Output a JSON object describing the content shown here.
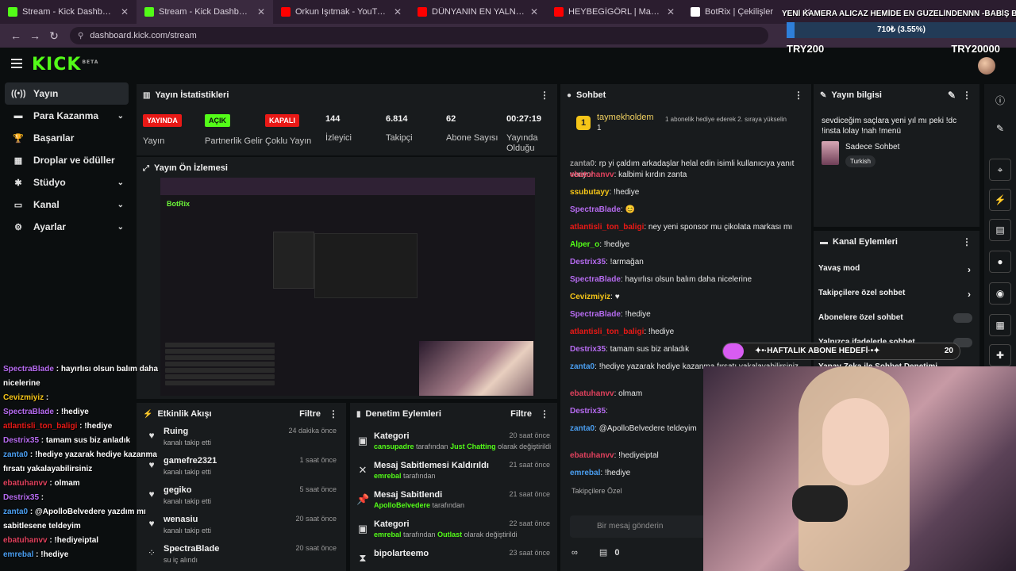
{
  "tabs": [
    {
      "label": "Stream - Kick Dashboard",
      "color": "#53fc18"
    },
    {
      "label": "Stream - Kick Dashboard",
      "color": "#53fc18"
    },
    {
      "label": "Orkun Işıtmak - YouTube",
      "color": "#ff0000"
    },
    {
      "label": "DÜNYANIN EN YALNIZ EVİNDE",
      "color": "#ff0000"
    },
    {
      "label": "HEYBEGİGÖRL | Madara Olduk",
      "color": "#ff0000"
    },
    {
      "label": "BotRix | Çekilişler",
      "color": "#ffffff"
    }
  ],
  "url": "dashboard.kick.com/stream",
  "goal": {
    "title": "YENİ KAMERA ALICAZ HEMİDE EN GÜZELİNDENNN -BABİŞ BABI",
    "progress_text": "710₺ (3.55%)",
    "progress_fraction": 0.0355,
    "min": "TRY200",
    "max": "TRY20000"
  },
  "sidebar": [
    {
      "label": "Yayın",
      "icon": "broadcast-icon",
      "glyph": "((•))",
      "chevron": false
    },
    {
      "label": "Para Kazanma",
      "icon": "wallet-icon",
      "glyph": "▬",
      "chevron": true
    },
    {
      "label": "Başarılar",
      "icon": "trophy-icon",
      "glyph": "🏆",
      "chevron": false
    },
    {
      "label": "Droplar ve ödüller",
      "icon": "gift-icon",
      "glyph": "▦",
      "chevron": false
    },
    {
      "label": "Stüdyo",
      "icon": "settings-icon",
      "glyph": "✱",
      "chevron": true
    },
    {
      "label": "Kanal",
      "icon": "channel-icon",
      "glyph": "▭",
      "chevron": true
    },
    {
      "label": "Ayarlar",
      "icon": "gear-icon",
      "glyph": "⚙",
      "chevron": true
    }
  ],
  "stats": {
    "title": "Yayın İstatistikleri",
    "items": [
      {
        "badge": "YAYINDA",
        "badge_color": "#e91916",
        "label": "Yayın"
      },
      {
        "badge": "AÇIK",
        "badge_color": "#53fc18",
        "label": "Partnerlik Gelir"
      },
      {
        "badge": "KAPALI",
        "badge_color": "#e91916",
        "label": "Çoklu Yayın"
      },
      {
        "value": "144",
        "label": "İzleyici"
      },
      {
        "value": "6.814",
        "label": "Takipçi"
      },
      {
        "value": "62",
        "label": "Abone Sayısı"
      },
      {
        "value": "00:27:19",
        "label": "Yayında Olduğu"
      }
    ]
  },
  "preview": {
    "title": "Yayın Ön İzlemesi",
    "botrix": "BotRix"
  },
  "feed": {
    "title": "Etkinlik Akışı",
    "filter": "Filtre",
    "items": [
      {
        "name": "Ruing",
        "desc": "kanalı takip etti",
        "time": "24 dakika önce",
        "icon": "heart-icon",
        "glyph": "♥"
      },
      {
        "name": "gamefre2321",
        "desc": "kanalı takip etti",
        "time": "1 saat önce",
        "icon": "heart-icon",
        "glyph": "♥"
      },
      {
        "name": "gegiko",
        "desc": "kanalı takip etti",
        "time": "5 saat önce",
        "icon": "heart-icon",
        "glyph": "♥"
      },
      {
        "name": "wenasiu",
        "desc": "kanalı takip etti",
        "time": "20 saat önce",
        "icon": "heart-icon",
        "glyph": "♥"
      },
      {
        "name": "SpectraBlade",
        "desc": "su iç alındı",
        "time": "20 saat önce",
        "icon": "redeem-icon",
        "glyph": "⁘"
      }
    ]
  },
  "mod": {
    "title": "Denetim Eylemleri",
    "filter": "Filtre",
    "items": [
      {
        "title": "Kategori",
        "user": "cansupadre",
        "mid": " tarafından ",
        "target": "Just Chatting",
        "tail": " olarak değiştirildi",
        "time": "20 saat önce",
        "icon": "category-icon",
        "glyph": "▣"
      },
      {
        "title": "Mesaj Sabitlemesi Kaldırıldı",
        "user": "emrebal",
        "mid": " tarafından",
        "target": "",
        "tail": "",
        "time": "21 saat önce",
        "icon": "unpin-icon",
        "glyph": "✕"
      },
      {
        "title": "Mesaj Sabitlendi",
        "user": "ApolloBelvedere",
        "mid": " tarafından",
        "target": "",
        "tail": "",
        "time": "21 saat önce",
        "icon": "pin-icon",
        "glyph": "📌"
      },
      {
        "title": "Kategori",
        "user": "emrebal",
        "mid": " tarafından ",
        "target": "Outlast",
        "tail": " olarak değiştirildi",
        "time": "22 saat önce",
        "icon": "category-icon",
        "glyph": "▣"
      },
      {
        "title": "bipolarteemo",
        "user": "",
        "mid": "",
        "target": "",
        "tail": "",
        "time": "23 saat önce",
        "icon": "hourglass-icon",
        "glyph": "⧗"
      }
    ]
  },
  "chat": {
    "title": "Sohbet",
    "pinned_user": "taymekholdem",
    "pinned_count": "1",
    "pinned_msg": "1 abonelik hediye ederek 2. sıraya yükselin",
    "messages": [
      {
        "user": "zanta0",
        "color": "#9a9a9a",
        "text": "rp yi çaldım arkadaşlar helal edin isimli kullanıcıya yanıt veriyor"
      },
      {
        "user": "ebatuhanvv",
        "color": "#e0415d",
        "text": "kalbimi kırdın zanta"
      },
      {
        "user": "ssubutayy",
        "color": "#f5c518",
        "text": "!hediye"
      },
      {
        "user": "SpectraBlade",
        "color": "#b66bf0",
        "text": "😊"
      },
      {
        "user": "atlantisli_ton_baligi",
        "color": "#e91916",
        "text": "ney yeni sponsor mu çikolata markası mı"
      },
      {
        "user": "Alper_o",
        "color": "#53fc18",
        "text": "!hediye"
      },
      {
        "user": "Destrix35",
        "color": "#b66bf0",
        "text": "!armağan"
      },
      {
        "user": "SpectraBlade",
        "color": "#b66bf0",
        "text": "hayırlısı olsun balım daha nicelerine"
      },
      {
        "user": "Cevizmiyiz",
        "color": "#f5c518",
        "text": "♥"
      },
      {
        "user": "SpectraBlade",
        "color": "#b66bf0",
        "text": "!hediye"
      },
      {
        "user": "atlantisli_ton_baligi",
        "color": "#e91916",
        "text": "!hediye"
      },
      {
        "user": "Destrix35",
        "color": "#b66bf0",
        "text": "tamam sus biz anladık"
      },
      {
        "user": "zanta0",
        "color": "#4a9ef0",
        "text": "!hediye yazarak hediye kazanma fırsatı yakalayabilirsiniz"
      },
      {
        "user": "ebatuhanvv",
        "color": "#e0415d",
        "text": "olmam"
      },
      {
        "user": "Destrix35",
        "color": "#b66bf0",
        "text": ""
      },
      {
        "user": "zanta0",
        "color": "#4a9ef0",
        "text": "@ApolloBelvedere teldeyim"
      },
      {
        "user": "ebatuhanvv",
        "color": "#e0415d",
        "text": "!hediyeiptal"
      },
      {
        "user": "emrebal",
        "color": "#4a9ef0",
        "text": "!hediye"
      }
    ],
    "followers_only": "Takipçilere Özel",
    "placeholder": "Bir mesaj gönderin",
    "footer_count": "0"
  },
  "info": {
    "title": "Yayın bilgisi",
    "stream_title": "sevdiceğim saçlara yeni yıl mı peki !dc !insta lolay !nah !menü",
    "category": "Sadece Sohbet",
    "tag": "Turkish"
  },
  "actions": {
    "title": "Kanal Eylemleri",
    "rows": [
      {
        "label": "Yavaş mod",
        "kind": "arrow"
      },
      {
        "label": "Takipçilere özel sohbet",
        "kind": "arrow"
      },
      {
        "label": "Abonelere özel sohbet",
        "kind": "toggle"
      },
      {
        "label": "Yalnızca ifadelerle sohbet",
        "kind": "toggle"
      },
      {
        "label": "Yapay Zeka ile Sohbet Denetimi",
        "kind": "none"
      }
    ]
  },
  "weekly_goal": {
    "text": "✦•·HAFTALIK ABONE HEDEFİ·•✦",
    "count": "20"
  },
  "overlay_chat": [
    {
      "user": "SpectraBlade",
      "color": "#b66bf0",
      "text": "hayırlısı olsun balım daha"
    },
    {
      "user": "",
      "color": "#ffffff",
      "text": "nicelerine"
    },
    {
      "user": "Cevizmiyiz",
      "color": "#f5c518",
      "text": ""
    },
    {
      "user": "SpectraBlade",
      "color": "#b66bf0",
      "text": "!hediye"
    },
    {
      "user": "atlantisli_ton_baligi",
      "color": "#e91916",
      "text": "!hediye"
    },
    {
      "user": "Destrix35",
      "color": "#b66bf0",
      "text": "tamam sus biz anladık"
    },
    {
      "user": "zanta0",
      "color": "#4a9ef0",
      "text": "!hediye yazarak hediye kazanma"
    },
    {
      "user": "",
      "color": "#ffffff",
      "text": "fırsatı yakalayabilirsiniz"
    },
    {
      "user": "ebatuhanvv",
      "color": "#e0415d",
      "text": "olmam"
    },
    {
      "user": "Destrix35",
      "color": "#b66bf0",
      "text": ""
    },
    {
      "user": "zanta0",
      "color": "#4a9ef0",
      "text": "@ApolloBelvedere yazdım mı"
    },
    {
      "user": "",
      "color": "#ffffff",
      "text": "sabitlesene teldeyim"
    },
    {
      "user": "ebatuhanvv",
      "color": "#e0415d",
      "text": "!hediyeiptal"
    },
    {
      "user": "emrebal",
      "color": "#4a9ef0",
      "text": "!hediye"
    }
  ]
}
